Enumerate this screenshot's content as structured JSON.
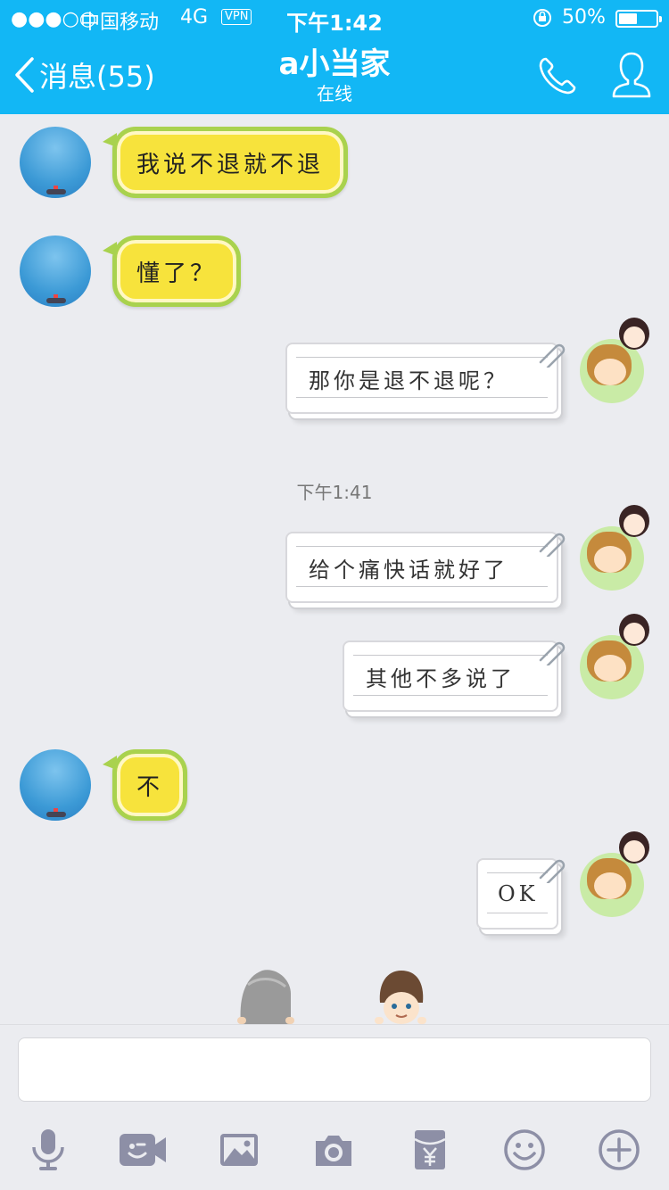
{
  "status_bar": {
    "signal": "●●●○○",
    "carrier": "中国移动",
    "network": "4G",
    "vpn": "VPN",
    "time": "下午1:42",
    "battery": "50%"
  },
  "header": {
    "back_label": "消息(55)",
    "title": "a小当家",
    "subtitle": "在线"
  },
  "timestamp": "下午1:41",
  "messages": [
    {
      "side": "left",
      "text": "我说不退就不退"
    },
    {
      "side": "left",
      "text": "懂了？"
    },
    {
      "side": "right",
      "text": "那你是退不退呢？"
    },
    {
      "side": "right",
      "text": "给个痛快话就好了"
    },
    {
      "side": "right",
      "text": "其他不多说了"
    },
    {
      "side": "left",
      "text": "不"
    },
    {
      "side": "right",
      "text": "OK"
    }
  ],
  "input": {
    "placeholder": "",
    "value": ""
  },
  "toolbar": [
    "microphone-icon",
    "video-icon",
    "image-icon",
    "camera-icon",
    "red-packet-icon",
    "emoji-icon",
    "plus-icon"
  ],
  "colors": {
    "accent": "#12b7f5",
    "toolbar_icon": "#8d8fa6",
    "bubble_left": "#f7e33c",
    "bubble_left_border": "#a9d24e"
  }
}
